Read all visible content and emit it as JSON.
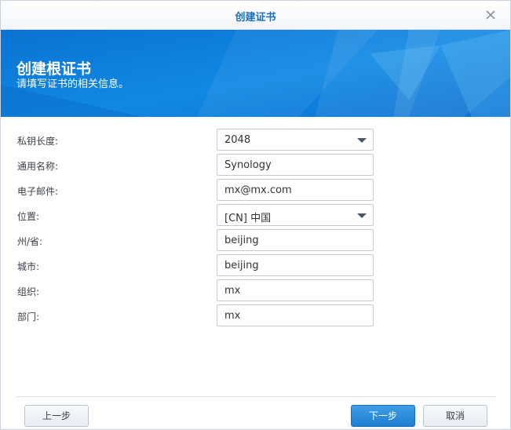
{
  "window": {
    "title": "创建证书"
  },
  "banner": {
    "heading": "创建根证书",
    "subheading": "请填写证书的相关信息。"
  },
  "form": {
    "fields": [
      {
        "label": "私钥长度:",
        "value": "2048",
        "type": "select"
      },
      {
        "label": "通用名称:",
        "value": "Synology",
        "type": "text"
      },
      {
        "label": "电子邮件:",
        "value": "mx@mx.com",
        "type": "text"
      },
      {
        "label": "位置:",
        "value": "[CN] 中国",
        "type": "select"
      },
      {
        "label": "州/省:",
        "value": "beijing",
        "type": "text"
      },
      {
        "label": "城市:",
        "value": "beijing",
        "type": "text"
      },
      {
        "label": "组织:",
        "value": "mx",
        "type": "text"
      },
      {
        "label": "部门:",
        "value": "mx",
        "type": "text"
      }
    ]
  },
  "footer": {
    "prev_label": "上一步",
    "next_label": "下一步",
    "cancel_label": "取消"
  },
  "colors": {
    "accent": "#1f7fd1",
    "banner": "#0a7bd8",
    "title": "#1a6fb5"
  },
  "icons": {
    "close": "close-icon",
    "dropdown": "chevron-down-icon"
  }
}
